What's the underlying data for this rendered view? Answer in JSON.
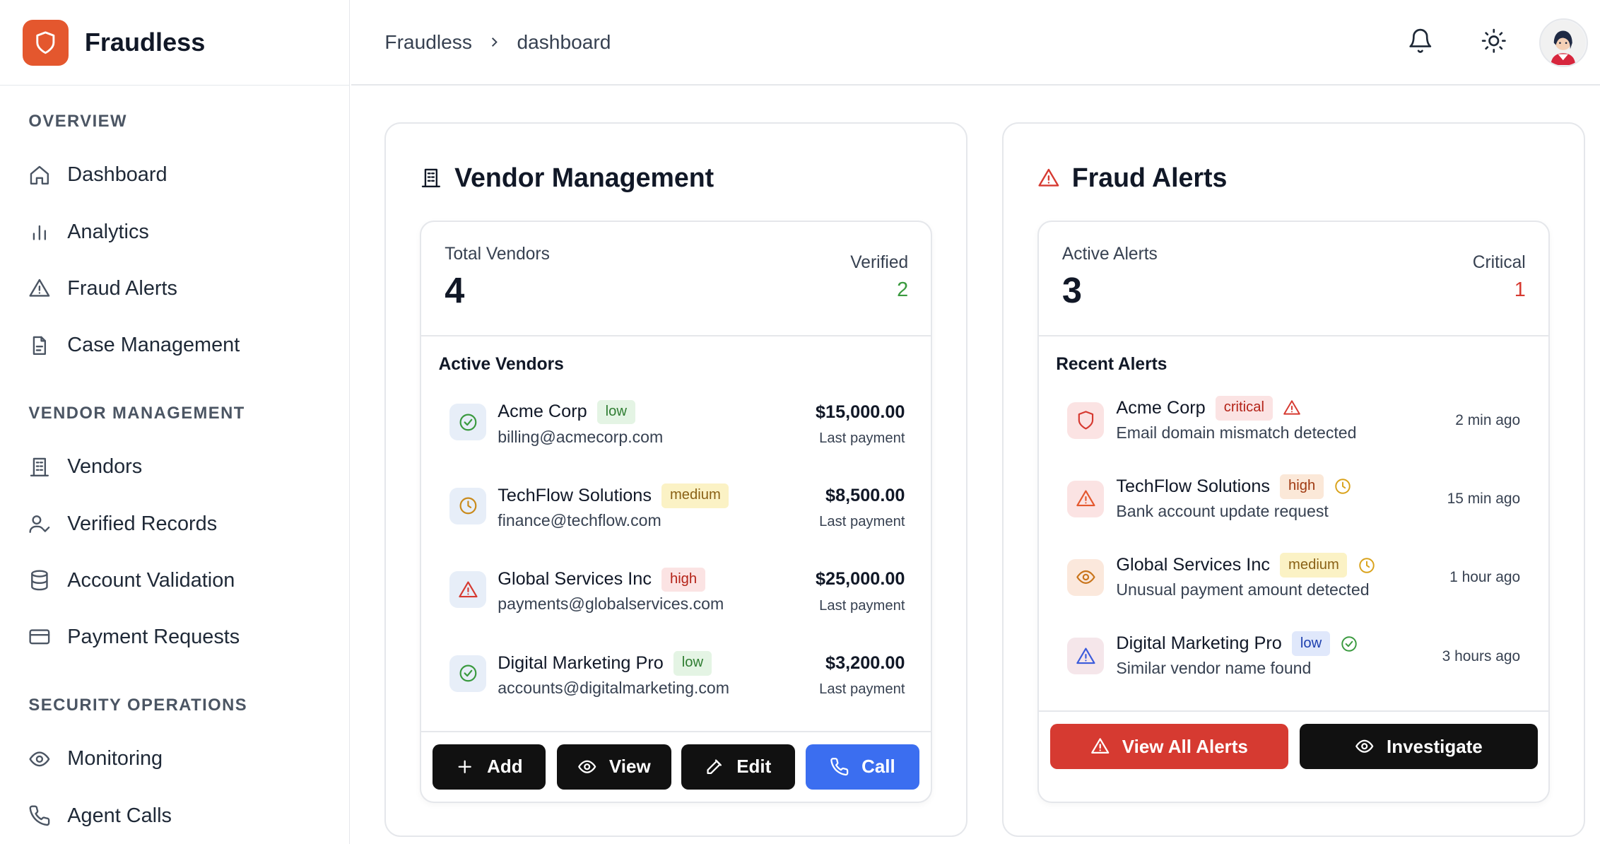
{
  "app": {
    "name": "Fraudless"
  },
  "breadcrumb": {
    "root": "Fraudless",
    "current": "dashboard"
  },
  "sidebar": {
    "sections": [
      {
        "title": "OVERVIEW",
        "items": [
          {
            "label": "Dashboard",
            "icon": "home-icon"
          },
          {
            "label": "Analytics",
            "icon": "bar-chart-icon"
          },
          {
            "label": "Fraud Alerts",
            "icon": "warning-triangle-icon"
          },
          {
            "label": "Case Management",
            "icon": "file-icon"
          }
        ]
      },
      {
        "title": "VENDOR MANAGEMENT",
        "items": [
          {
            "label": "Vendors",
            "icon": "building-icon"
          },
          {
            "label": "Verified Records",
            "icon": "user-check-icon"
          },
          {
            "label": "Account Validation",
            "icon": "database-icon"
          },
          {
            "label": "Payment Requests",
            "icon": "credit-card-icon"
          }
        ]
      },
      {
        "title": "SECURITY OPERATIONS",
        "items": [
          {
            "label": "Monitoring",
            "icon": "eye-icon"
          },
          {
            "label": "Agent Calls",
            "icon": "phone-icon"
          }
        ]
      }
    ]
  },
  "vendor_card": {
    "title": "Vendor Management",
    "total_label": "Total Vendors",
    "total_value": "4",
    "verified_label": "Verified",
    "verified_value": "2",
    "list_title": "Active Vendors",
    "vendors": [
      {
        "name": "Acme Corp",
        "risk": "low",
        "email": "billing@acmecorp.com",
        "amount": "$15,000.00",
        "amount_label": "Last payment",
        "status_icon": "check-circle-icon"
      },
      {
        "name": "TechFlow Solutions",
        "risk": "medium",
        "email": "finance@techflow.com",
        "amount": "$8,500.00",
        "amount_label": "Last payment",
        "status_icon": "clock-icon"
      },
      {
        "name": "Global Services Inc",
        "risk": "high",
        "email": "payments@globalservices.com",
        "amount": "$25,000.00",
        "amount_label": "Last payment",
        "status_icon": "warning-triangle-icon"
      },
      {
        "name": "Digital Marketing Pro",
        "risk": "low",
        "email": "accounts@digitalmarketing.com",
        "amount": "$3,200.00",
        "amount_label": "Last payment",
        "status_icon": "check-circle-icon"
      }
    ],
    "actions": {
      "add": "Add",
      "view": "View",
      "edit": "Edit",
      "call": "Call"
    }
  },
  "alerts_card": {
    "title": "Fraud Alerts",
    "active_label": "Active Alerts",
    "active_value": "3",
    "critical_label": "Critical",
    "critical_value": "1",
    "list_title": "Recent Alerts",
    "alerts": [
      {
        "vendor": "Acme Corp",
        "severity": "critical",
        "description": "Email domain mismatch detected",
        "time": "2 min ago"
      },
      {
        "vendor": "TechFlow Solutions",
        "severity": "high",
        "description": "Bank account update request",
        "time": "15 min ago"
      },
      {
        "vendor": "Global Services Inc",
        "severity": "medium",
        "description": "Unusual payment amount detected",
        "time": "1 hour ago"
      },
      {
        "vendor": "Digital Marketing Pro",
        "severity": "low",
        "description": "Similar vendor name found",
        "time": "3 hours ago"
      }
    ],
    "actions": {
      "view_all": "View All Alerts",
      "investigate": "Investigate"
    }
  },
  "colors": {
    "brand": "#e4572e",
    "verified_green": "#3a9a3f",
    "critical_red": "#d63a31",
    "primary_blue": "#3b6ef0"
  }
}
